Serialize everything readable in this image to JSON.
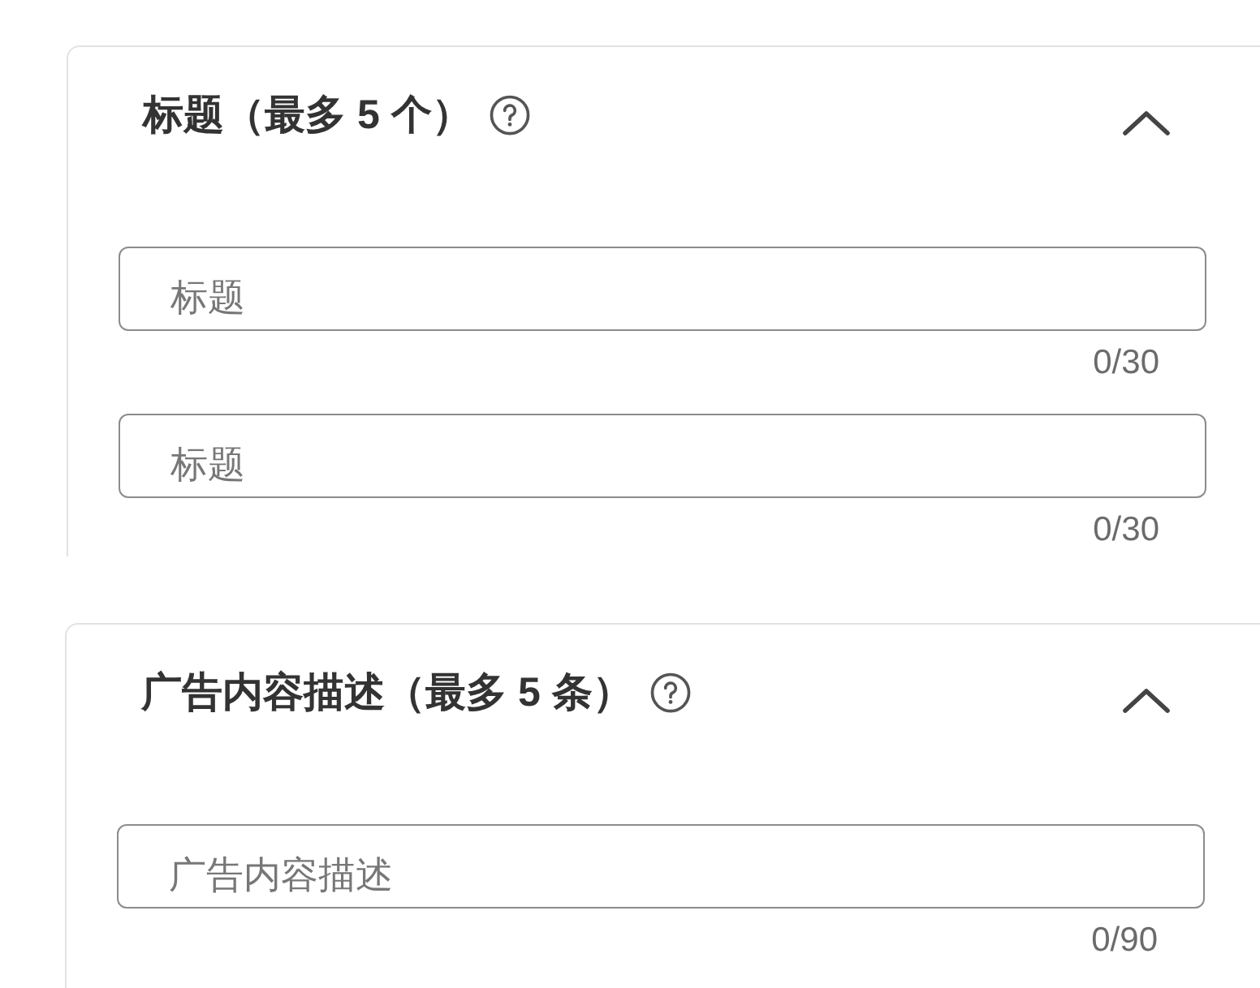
{
  "sections": [
    {
      "title": "标题（最多 5 个）",
      "expanded": true,
      "fields": [
        {
          "placeholder": "标题",
          "counter": "0/30"
        },
        {
          "placeholder": "标题",
          "counter": "0/30"
        }
      ]
    },
    {
      "title": "广告内容描述（最多 5 条）",
      "expanded": true,
      "fields": [
        {
          "placeholder": "广告内容描述",
          "counter": "0/90"
        }
      ]
    }
  ]
}
